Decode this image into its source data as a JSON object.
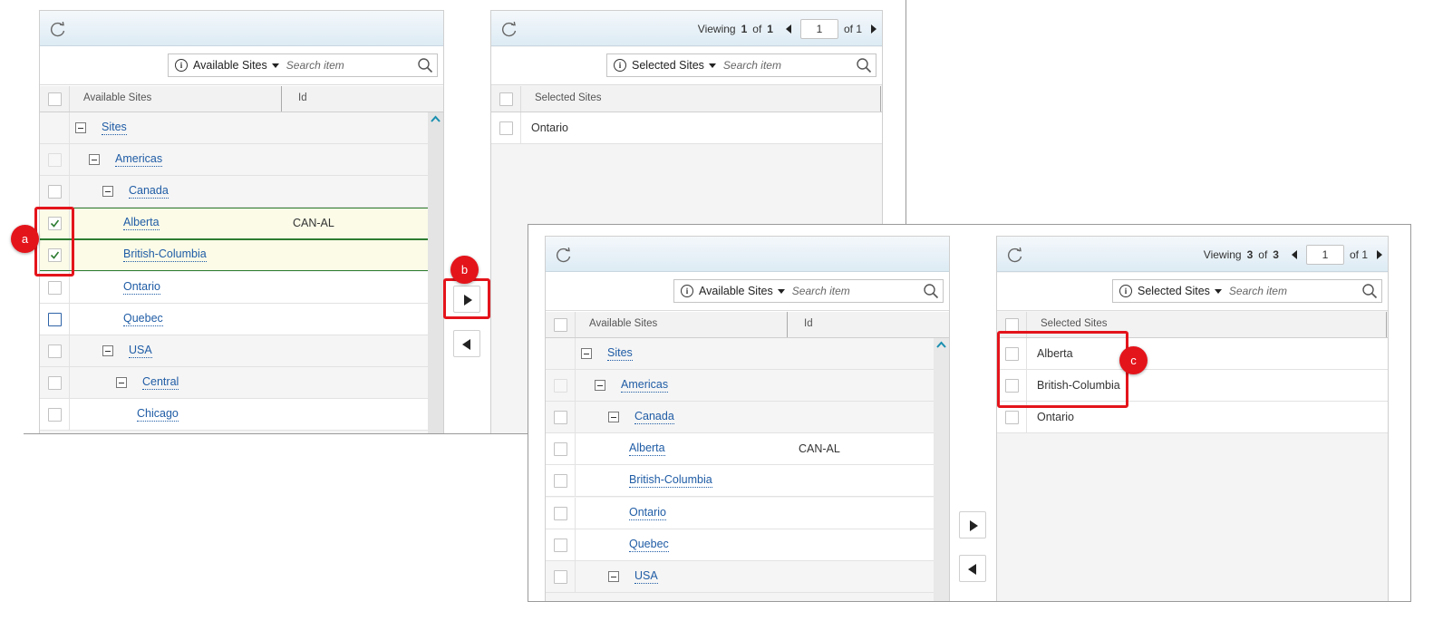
{
  "colors": {
    "accent": "#1f5ca5",
    "highlight": "#e4141b",
    "selected_row": "#fbfbe8",
    "check": "#2e7d32"
  },
  "icons": {
    "refresh": "refresh-icon",
    "info": "info-icon",
    "search": "search-icon",
    "collapse": "minus-box-icon",
    "check": "checkmark-icon"
  },
  "left_screenshot": {
    "available": {
      "scope_label": "Available Sites",
      "search_placeholder": "Search item",
      "col_name": "Available Sites",
      "col_id": "Id",
      "rows": [
        {
          "label": "Sites",
          "id": ""
        },
        {
          "label": "Americas",
          "id": ""
        },
        {
          "label": "Canada",
          "id": ""
        },
        {
          "label": "Alberta",
          "id": "CAN-AL"
        },
        {
          "label": "British-Columbia",
          "id": ""
        },
        {
          "label": "Ontario",
          "id": ""
        },
        {
          "label": "Quebec",
          "id": ""
        },
        {
          "label": "USA",
          "id": ""
        },
        {
          "label": "Central",
          "id": ""
        },
        {
          "label": "Chicago",
          "id": ""
        }
      ]
    },
    "selected": {
      "viewing_label": "Viewing",
      "viewing_start": "1",
      "viewing_of": "of",
      "viewing_total": "1",
      "page_value": "1",
      "page_of_label": "of 1",
      "scope_label": "Selected Sites",
      "search_placeholder": "Search item",
      "col_name": "Selected Sites",
      "rows": [
        "Ontario"
      ]
    }
  },
  "right_screenshot": {
    "available": {
      "scope_label": "Available Sites",
      "search_placeholder": "Search item",
      "col_name": "Available Sites",
      "col_id": "Id",
      "rows": [
        {
          "label": "Sites",
          "id": ""
        },
        {
          "label": "Americas",
          "id": ""
        },
        {
          "label": "Canada",
          "id": ""
        },
        {
          "label": "Alberta",
          "id": "CAN-AL"
        },
        {
          "label": "British-Columbia",
          "id": ""
        },
        {
          "label": "Ontario",
          "id": ""
        },
        {
          "label": "Quebec",
          "id": ""
        },
        {
          "label": "USA",
          "id": ""
        }
      ]
    },
    "selected": {
      "viewing_label": "Viewing",
      "viewing_start": "3",
      "viewing_of": "of",
      "viewing_total": "3",
      "page_value": "1",
      "page_of_label": "of 1",
      "scope_label": "Selected Sites",
      "search_placeholder": "Search item",
      "col_name": "Selected Sites",
      "rows": [
        "Alberta",
        "British-Columbia",
        "Ontario"
      ]
    }
  },
  "callouts": {
    "a": "a",
    "b": "b",
    "c": "c"
  }
}
